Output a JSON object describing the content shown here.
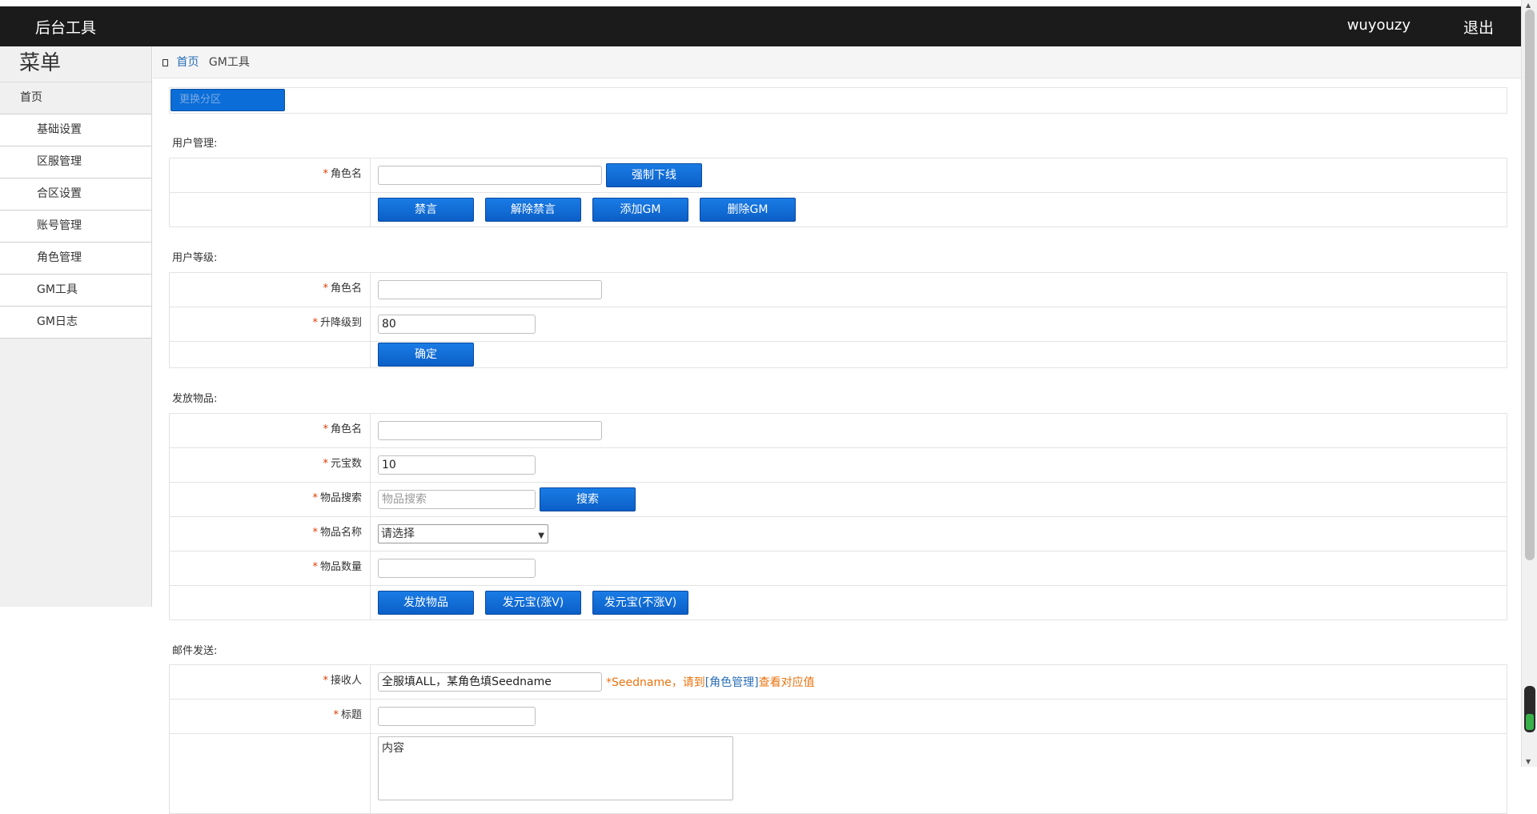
{
  "header": {
    "brand": "后台工具",
    "user": "wuyouzy",
    "logout": "退出"
  },
  "sidebar": {
    "title": "菜单",
    "items": [
      {
        "label": "首页",
        "type": "home"
      },
      {
        "label": "基础设置",
        "type": "sub"
      },
      {
        "label": "区服管理",
        "type": "sub"
      },
      {
        "label": "合区设置",
        "type": "sub"
      },
      {
        "label": "账号管理",
        "type": "sub"
      },
      {
        "label": "角色管理",
        "type": "sub"
      },
      {
        "label": "GM工具",
        "type": "sub"
      },
      {
        "label": "GM日志",
        "type": "sub"
      }
    ]
  },
  "breadcrumb": {
    "home": "首页",
    "current": "GM工具"
  },
  "area": {
    "button": "更换分区"
  },
  "user_manage": {
    "title": "用户管理:",
    "role_label": "角色名",
    "role_value": "",
    "kick_button": "强制下线",
    "buttons": [
      "禁言",
      "解除禁言",
      "添加GM",
      "删除GM"
    ]
  },
  "user_level": {
    "title": "用户等级:",
    "role_label": "角色名",
    "role_value": "",
    "level_label": "升降级到",
    "level_value": "80",
    "confirm_button": "确定"
  },
  "give_items": {
    "title": "发放物品:",
    "role_label": "角色名",
    "role_value": "",
    "yuanbao_label": "元宝数",
    "yuanbao_value": "10",
    "search_label": "物品搜索",
    "search_placeholder": "物品搜索",
    "search_button": "搜索",
    "item_name_label": "物品名称",
    "item_name_selected": "请选择",
    "item_count_label": "物品数量",
    "item_count_value": "",
    "buttons": [
      "发放物品",
      "发元宝(涨V)",
      "发元宝(不涨V)"
    ]
  },
  "mail": {
    "title": "邮件发送:",
    "receiver_label": "接收人",
    "receiver_value": "全服填ALL，某角色填Seedname",
    "receiver_hint_prefix": "*Seedname，请到",
    "receiver_hint_link": "[角色管理]",
    "receiver_hint_suffix": "查看对应值",
    "subject_label": "标题",
    "subject_value": "",
    "content_value": "内容"
  },
  "icons": {
    "select_chevron": "chevron-down-icon",
    "breadcrumb": "home-icon"
  },
  "colors": {
    "topbar": "#1b1b1b",
    "button": "#0b6ed8",
    "required_star": "#e03a00",
    "hint": "#e8730f",
    "link": "#2a6fb8"
  }
}
